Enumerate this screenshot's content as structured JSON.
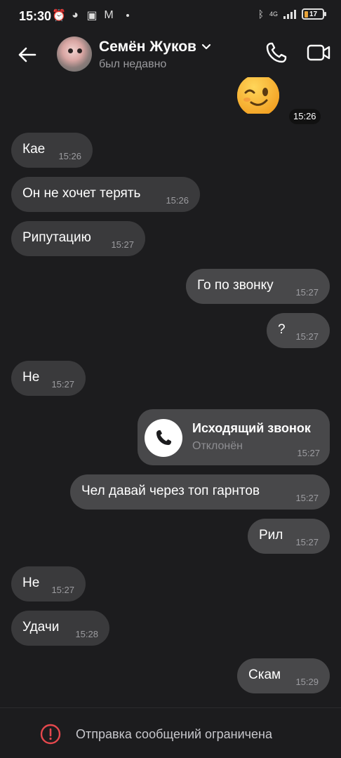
{
  "status_bar": {
    "time": "15:30",
    "network": "4G",
    "battery": "17"
  },
  "header": {
    "contact_name": "Семён Жуков",
    "contact_status": "был недавно"
  },
  "emoji_message": {
    "emoji": "winking-face",
    "time": "15:26"
  },
  "messages": [
    {
      "text": "Кае",
      "time": "15:26",
      "direction": "in"
    },
    {
      "text": "Он не хочет терять",
      "time": "15:26",
      "direction": "in"
    },
    {
      "text": "Рипутацию",
      "time": "15:27",
      "direction": "in"
    },
    {
      "text": "Го по звонку",
      "time": "15:27",
      "direction": "out"
    },
    {
      "text": "?",
      "time": "15:27",
      "direction": "out"
    },
    {
      "text": "Не",
      "time": "15:27",
      "direction": "in"
    },
    {
      "text": "Чел давай через топ гарнтов",
      "time": "15:27",
      "direction": "out"
    },
    {
      "text": "Рил",
      "time": "15:27",
      "direction": "out"
    },
    {
      "text": "Не",
      "time": "15:27",
      "direction": "in"
    },
    {
      "text": "Удачи",
      "time": "15:28",
      "direction": "in"
    },
    {
      "text": "Скам",
      "time": "15:29",
      "direction": "out"
    }
  ],
  "call_card": {
    "title": "Исходящий звонок",
    "subtitle": "Отклонён",
    "time": "15:27"
  },
  "footer": {
    "notice": "Отправка сообщений ограничена",
    "warning_color": "#e5484d"
  },
  "colors": {
    "background": "#1c1c1e",
    "bubble_in": "#3a3a3c",
    "bubble_out": "#48484a"
  }
}
